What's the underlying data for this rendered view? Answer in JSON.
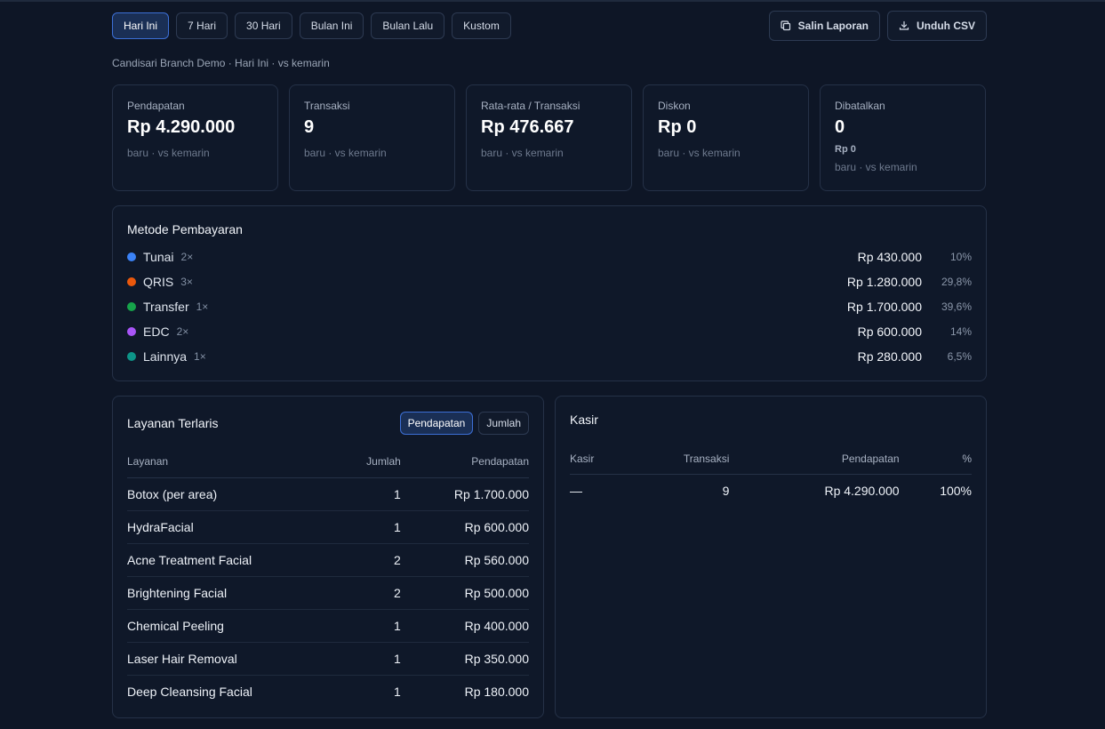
{
  "ranges": [
    "Hari Ini",
    "7 Hari",
    "30 Hari",
    "Bulan Ini",
    "Bulan Lalu",
    "Kustom"
  ],
  "active_range": "Hari Ini",
  "actions": {
    "copy_label": "Salin Laporan",
    "csv_label": "Unduh CSV"
  },
  "context": "Candisari Branch Demo · Hari Ini · vs kemarin",
  "stats": [
    {
      "label": "Pendapatan",
      "value": "Rp 4.290.000",
      "delta": "baru · vs kemarin"
    },
    {
      "label": "Transaksi",
      "value": "9",
      "delta": "baru · vs kemarin"
    },
    {
      "label": "Rata-rata / Transaksi",
      "value": "Rp 476.667",
      "delta": "baru · vs kemarin"
    },
    {
      "label": "Diskon",
      "value": "Rp 0",
      "delta": "baru · vs kemarin"
    },
    {
      "label": "Dibatalkan",
      "value": "0",
      "sub": "Rp 0",
      "delta": "baru · vs kemarin"
    }
  ],
  "payments": {
    "title": "Metode Pembayaran",
    "items": [
      {
        "name": "Tunai",
        "count": "2×",
        "amount": "Rp 430.000",
        "pct": "10%",
        "color": "#3b82f6"
      },
      {
        "name": "QRIS",
        "count": "3×",
        "amount": "Rp 1.280.000",
        "pct": "29,8%",
        "color": "#ea580c"
      },
      {
        "name": "Transfer",
        "count": "1×",
        "amount": "Rp 1.700.000",
        "pct": "39,6%",
        "color": "#16a34a"
      },
      {
        "name": "EDC",
        "count": "2×",
        "amount": "Rp 600.000",
        "pct": "14%",
        "color": "#a855f7"
      },
      {
        "name": "Lainnya",
        "count": "1×",
        "amount": "Rp 280.000",
        "pct": "6,5%",
        "color": "#0d9488"
      }
    ]
  },
  "services": {
    "title": "Layanan Terlaris",
    "toggle": [
      "Pendapatan",
      "Jumlah"
    ],
    "active_toggle": "Pendapatan",
    "columns": [
      "Layanan",
      "Jumlah",
      "Pendapatan"
    ],
    "rows": [
      {
        "name": "Botox (per area)",
        "qty": "1",
        "revenue": "Rp 1.700.000"
      },
      {
        "name": "HydraFacial",
        "qty": "1",
        "revenue": "Rp 600.000"
      },
      {
        "name": "Acne Treatment Facial",
        "qty": "2",
        "revenue": "Rp 560.000"
      },
      {
        "name": "Brightening Facial",
        "qty": "2",
        "revenue": "Rp 500.000"
      },
      {
        "name": "Chemical Peeling",
        "qty": "1",
        "revenue": "Rp 400.000"
      },
      {
        "name": "Laser Hair Removal",
        "qty": "1",
        "revenue": "Rp 350.000"
      },
      {
        "name": "Deep Cleansing Facial",
        "qty": "1",
        "revenue": "Rp 180.000"
      }
    ]
  },
  "cashier": {
    "title": "Kasir",
    "columns": [
      "Kasir",
      "Transaksi",
      "Pendapatan",
      "%"
    ],
    "rows": [
      {
        "name": "—",
        "tx": "9",
        "revenue": "Rp 4.290.000",
        "pct": "100%"
      }
    ]
  }
}
